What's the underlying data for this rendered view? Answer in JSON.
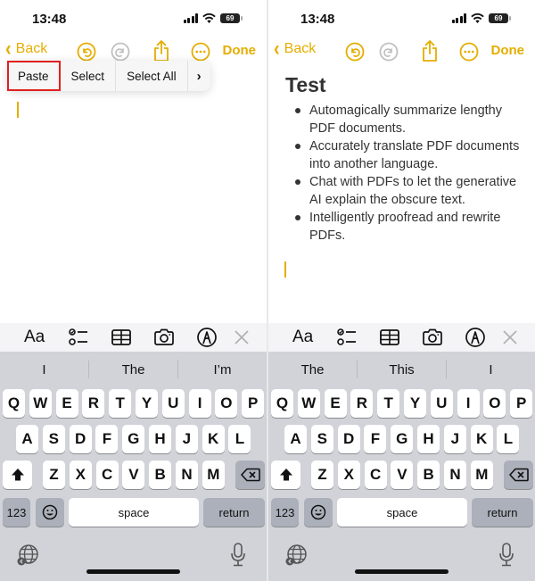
{
  "colors": {
    "accent": "#e5ad00",
    "highlight_box": "#e02020",
    "keyboard_bg": "#d1d3d9",
    "dark_key": "#abb0ba"
  },
  "status_bar": {
    "time": "13:48",
    "battery": "69"
  },
  "nav": {
    "back_label": "Back",
    "done_label": "Done",
    "icons": [
      "undo-icon",
      "redo-icon",
      "share-icon",
      "more-icon"
    ]
  },
  "left": {
    "edit_menu": {
      "items": [
        "Paste",
        "Select",
        "Select All"
      ],
      "more_glyph": "›",
      "highlighted": "Paste"
    },
    "suggestions": [
      "I",
      "The",
      "I’m"
    ]
  },
  "right": {
    "note": {
      "title": "Test",
      "bullets": [
        "Automagically summarize lengthy PDF documents.",
        "Accurately translate PDF documents into another language.",
        "Chat with PDFs to let the generative AI explain the obscure text.",
        "Intelligently proofread and rewrite PDFs."
      ]
    },
    "suggestions": [
      "The",
      "This",
      "I"
    ]
  },
  "format_bar": {
    "text_style_label": "Aa",
    "icons": [
      "text-format-icon",
      "checklist-icon",
      "table-icon",
      "camera-icon",
      "markup-icon",
      "close-icon"
    ]
  },
  "keyboard": {
    "row1": [
      "Q",
      "W",
      "E",
      "R",
      "T",
      "Y",
      "U",
      "I",
      "O",
      "P"
    ],
    "row2": [
      "A",
      "S",
      "D",
      "F",
      "G",
      "H",
      "J",
      "K",
      "L"
    ],
    "row3": [
      "Z",
      "X",
      "C",
      "V",
      "B",
      "N",
      "M"
    ],
    "numbers_label": "123",
    "space_label": "space",
    "return_label": "return"
  }
}
